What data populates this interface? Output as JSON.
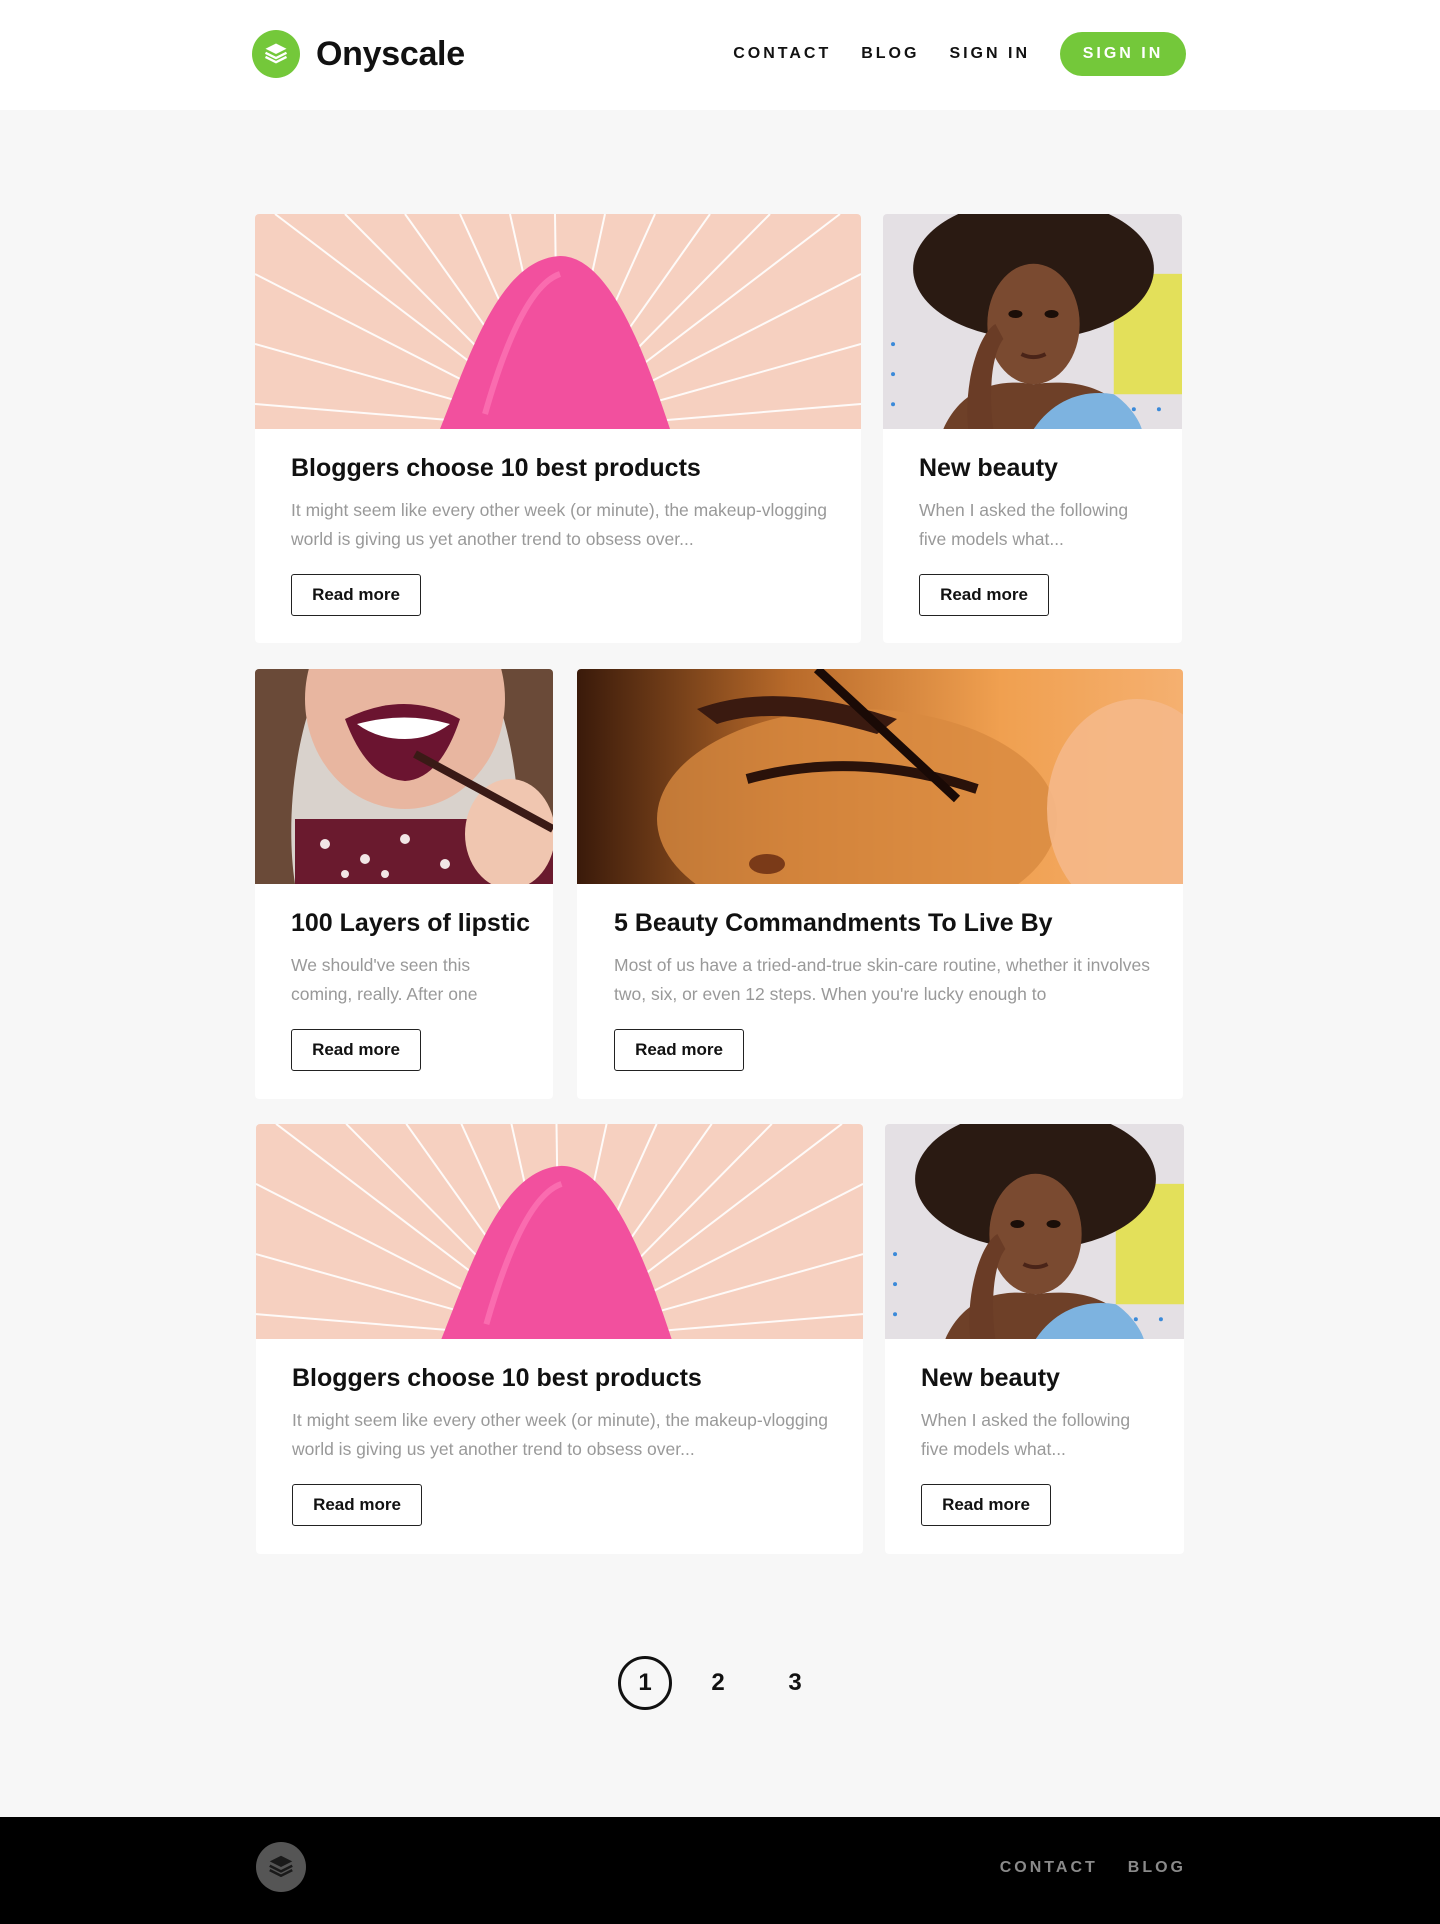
{
  "brand": {
    "name": "Onyscale",
    "accent": "#74c83a"
  },
  "nav": {
    "contact": "CONTACT",
    "blog": "BLOG",
    "sign_in": "SIGN IN",
    "sign_in_button": "SIGN IN"
  },
  "posts": [
    {
      "title": "Bloggers choose 10 best products",
      "excerpt": "It might seem like every other week (or minute), the makeup-vlogging world is giving us yet another trend to obsess over...",
      "button": "Read more",
      "image": "pink-sponge"
    },
    {
      "title": "New beauty",
      "excerpt": "When I asked the following five models what...",
      "button": "Read more",
      "image": "curly-hair-portrait"
    },
    {
      "title": "100 Layers of lipstic",
      "excerpt": "We should've seen this coming, really. After one",
      "button": "Read more",
      "image": "lipstick-application"
    },
    {
      "title": "5 Beauty Commandments To Live By",
      "excerpt": "Most of us have a tried-and-true skin-care routine, whether it involves two, six, or even 12 steps. When you're lucky enough to",
      "button": "Read more",
      "image": "mascara-application"
    },
    {
      "title": "Bloggers choose 10 best products",
      "excerpt": "It might seem like every other week (or minute), the makeup-vlogging world is giving us yet another trend to obsess over...",
      "button": "Read more",
      "image": "pink-sponge"
    },
    {
      "title": "New beauty",
      "excerpt": "When I asked the following five models what...",
      "button": "Read more",
      "image": "curly-hair-portrait"
    }
  ],
  "pagination": {
    "pages": [
      "1",
      "2",
      "3"
    ],
    "current": "1"
  },
  "footer": {
    "contact": "CONTACT",
    "blog": "BLOG"
  }
}
